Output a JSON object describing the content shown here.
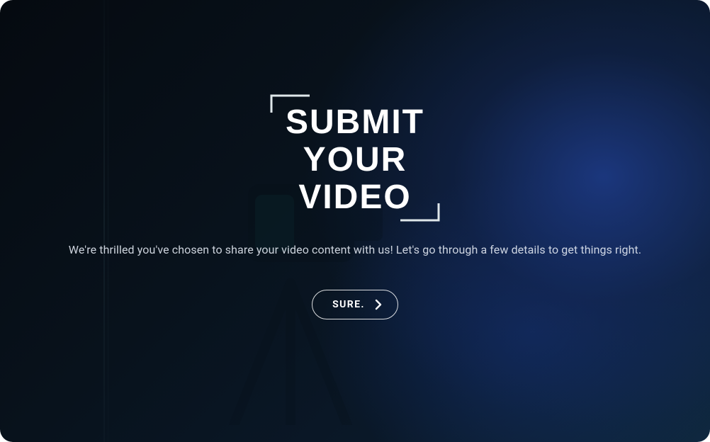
{
  "logo": {
    "line1": "SUBMIT",
    "line2": "YOUR",
    "line3": "VIDEO",
    "icon_name": "submit-your-video-logo"
  },
  "tagline": "We're thrilled you've chosen to share your video content with us! Let's go through a few details to get things right.",
  "cta": {
    "label": "SURE.",
    "icon_name": "chevron-right-icon"
  },
  "colors": {
    "text": "#e6ecf5",
    "button_border": "rgba(255,255,255,0.85)",
    "bg_gradient_dark": "#050a10",
    "bg_gradient_blue": "#0f2840"
  }
}
